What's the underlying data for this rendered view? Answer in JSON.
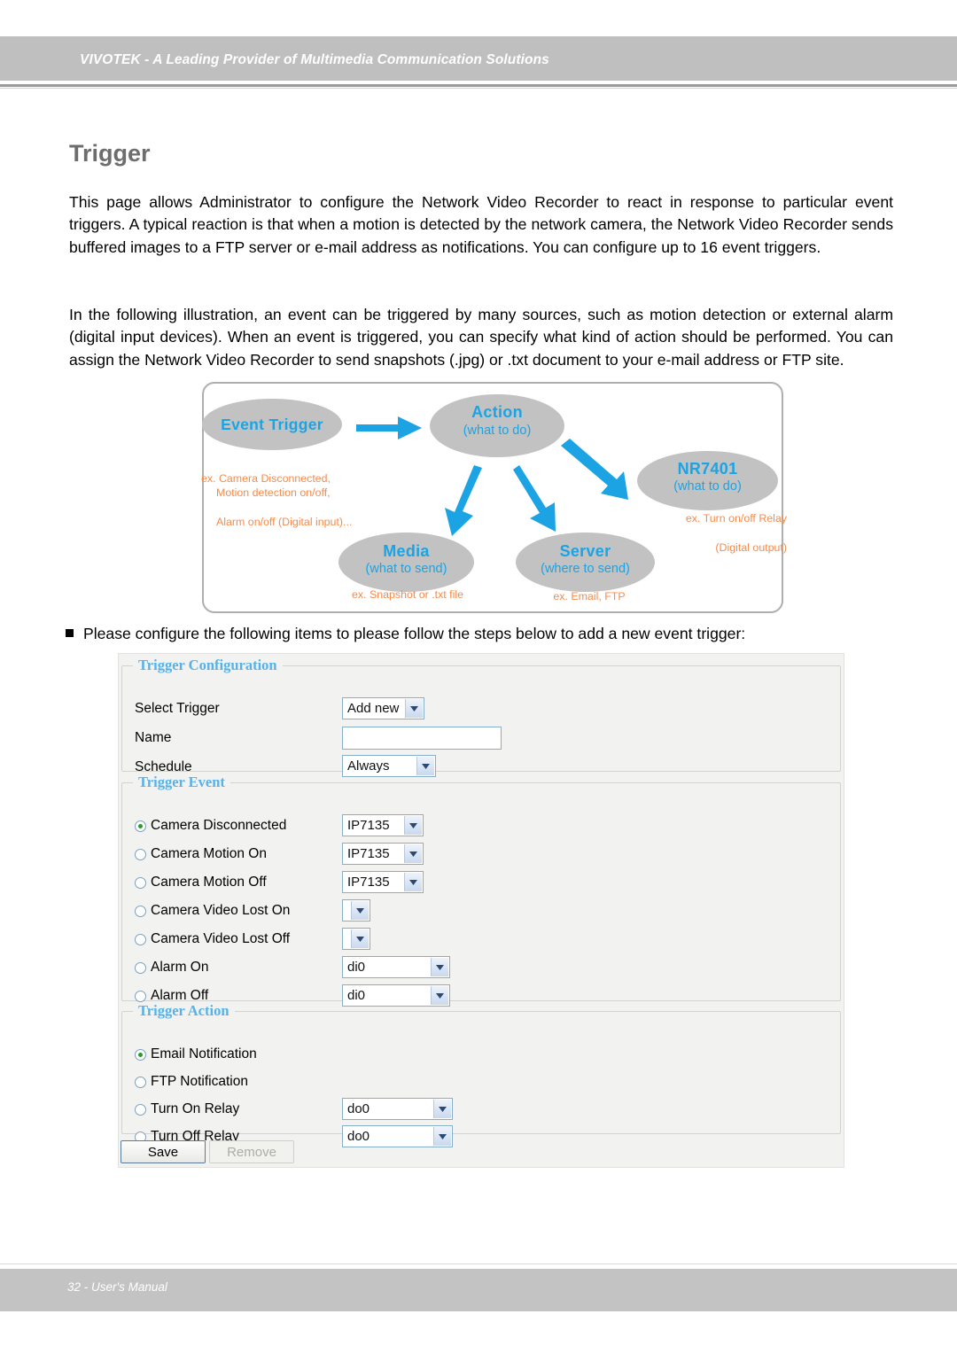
{
  "header": {
    "title": "VIVOTEK - A Leading Provider of Multimedia Communication Solutions"
  },
  "page": {
    "title": "Trigger",
    "paragraph1": "This page allows Administrator to configure the Network Video Recorder to react in response to particular event triggers. A typical reaction is that when a motion is detected by the network camera, the Network Video Recorder sends buffered images to a FTP server or e-mail address as notifications. You can configure up to 16 event triggers.",
    "paragraph2": "In the following illustration, an event can be triggered by many sources, such as motion detection or external alarm (digital input devices). When an event is triggered, you can specify what kind of action should be performed. You can assign the Network Video Recorder to send snapshots (.jpg) or .txt document to your e-mail address or FTP site.",
    "bullet_text": "Please configure the following items to please follow the steps below to add a new event trigger:"
  },
  "diagram": {
    "accent_blue": "#1ba3e3",
    "note_orange": "#f68b4a",
    "oval_gray": "#c2c2c2",
    "nodes": {
      "event_trigger": {
        "title": "Event Trigger",
        "sub": ""
      },
      "action": {
        "title": "Action",
        "sub": "(what to do)"
      },
      "nr7401": {
        "title": "NR7401",
        "sub": "(what to do)"
      },
      "media": {
        "title": "Media",
        "sub": "(what to send)"
      },
      "server": {
        "title": "Server",
        "sub": "(where to send)"
      }
    },
    "notes": {
      "event_trigger_l1": "ex. Camera Disconnected,",
      "event_trigger_l2": "Motion detection on/off,",
      "event_trigger_l3": "Alarm on/off (Digital input)...",
      "nr7401_l1": "ex. Turn on/off Relay",
      "nr7401_l2": "(Digital output)",
      "media": "ex. Snapshot or .txt file",
      "server": "ex. Email, FTP"
    }
  },
  "form": {
    "config": {
      "legend": "Trigger Configuration",
      "select_trigger_label": "Select Trigger",
      "select_trigger_value": "Add new",
      "name_label": "Name",
      "name_value": "",
      "name_placeholder": "",
      "schedule_label": "Schedule",
      "schedule_value": "Always"
    },
    "event": {
      "legend": "Trigger Event",
      "rows": [
        {
          "label": "Camera Disconnected",
          "checked": true,
          "select": "IP7135",
          "select_width": 92
        },
        {
          "label": "Camera Motion On",
          "checked": false,
          "select": "IP7135",
          "select_width": 92
        },
        {
          "label": "Camera Motion Off",
          "checked": false,
          "select": "IP7135",
          "select_width": 92
        },
        {
          "label": "Camera Video Lost On",
          "checked": false,
          "select": "",
          "select_width": 32
        },
        {
          "label": "Camera Video Lost Off",
          "checked": false,
          "select": "",
          "select_width": 32
        },
        {
          "label": "Alarm On",
          "checked": false,
          "select": "di0",
          "select_width": 122
        },
        {
          "label": "Alarm Off",
          "checked": false,
          "select": "di0",
          "select_width": 122
        }
      ]
    },
    "action": {
      "legend": "Trigger Action",
      "rows": [
        {
          "label": "Email Notification",
          "checked": true,
          "select": null,
          "select_width": 0
        },
        {
          "label": "FTP Notification",
          "checked": false,
          "select": null,
          "select_width": 0
        },
        {
          "label": "Turn On Relay",
          "checked": false,
          "select": "do0",
          "select_width": 125
        },
        {
          "label": "Turn Off Relay",
          "checked": false,
          "select": "do0",
          "select_width": 125
        }
      ]
    },
    "buttons": {
      "save": "Save",
      "remove": "Remove"
    }
  },
  "footer": {
    "text": "32 - User's Manual"
  }
}
